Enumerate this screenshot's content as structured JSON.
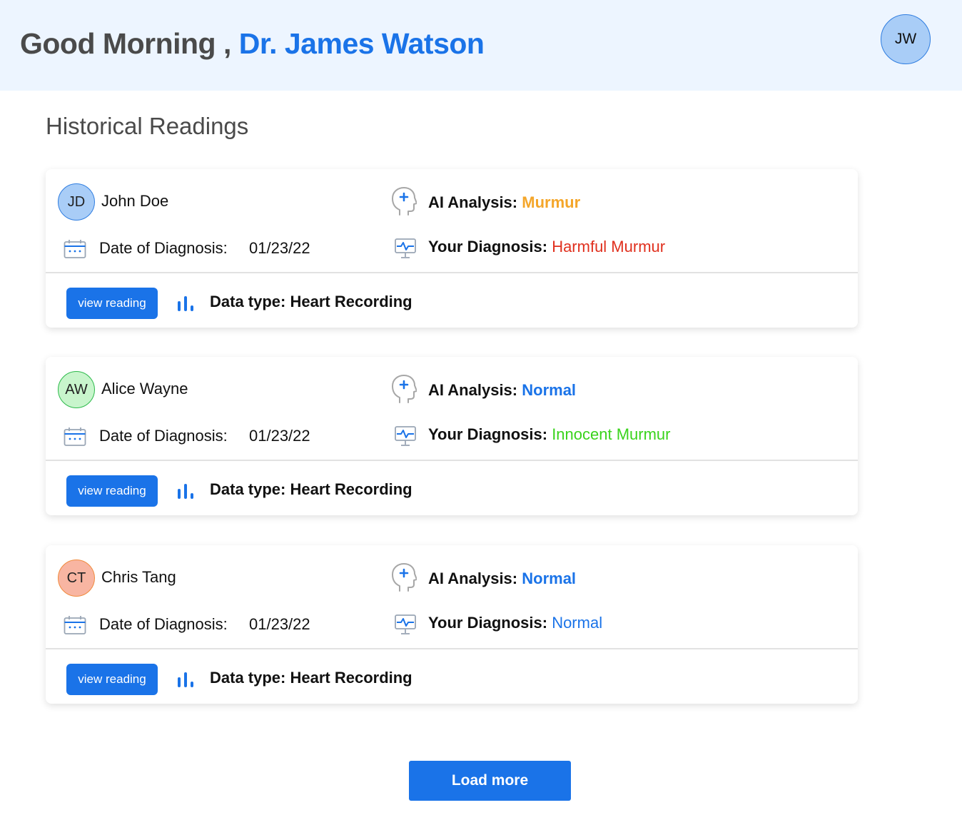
{
  "header": {
    "greeting_prefix": "Good Morning ,",
    "doctor_name": "Dr. James Watson",
    "avatar_initials": "JW"
  },
  "section_title": "Historical Readings",
  "labels": {
    "date_of_diagnosis": "Date of Diagnosis:",
    "ai_analysis": "AI Analysis:",
    "your_diagnosis": "Your Diagnosis:",
    "view_reading": "view reading",
    "data_type": "Data type: Heart Recording"
  },
  "readings": [
    {
      "initials": "JD",
      "patient_name": "John Doe",
      "date": "01/23/22",
      "ai_analysis": "Murmur",
      "ai_analysis_color": "#f4a62a",
      "your_diagnosis": "Harmful Murmur",
      "your_diagnosis_color": "#e0301e",
      "avatar_bg": "#a9cdf7",
      "avatar_border": "#2f7de0"
    },
    {
      "initials": "AW",
      "patient_name": "Alice Wayne",
      "date": "01/23/22",
      "ai_analysis": "Normal",
      "ai_analysis_color": "#1a73e8",
      "your_diagnosis": "Innocent Murmur",
      "your_diagnosis_color": "#3ad31c",
      "avatar_bg": "#c8f5cc",
      "avatar_border": "#2cb94a"
    },
    {
      "initials": "CT",
      "patient_name": "Chris Tang",
      "date": "01/23/22",
      "ai_analysis": "Normal",
      "ai_analysis_color": "#1a73e8",
      "your_diagnosis": "Normal",
      "your_diagnosis_color": "#1a73e8",
      "avatar_bg": "#f8b5a2",
      "avatar_border": "#f08a3c"
    }
  ],
  "load_more_label": "Load more",
  "icons": {
    "calendar": "calendar-icon",
    "ai_analysis": "head-plus-icon",
    "your_diagnosis": "monitor-pulse-icon",
    "data_type": "bar-chart-icon"
  },
  "colors": {
    "accent": "#1a73e8",
    "header_bg": "#edf5ff"
  }
}
